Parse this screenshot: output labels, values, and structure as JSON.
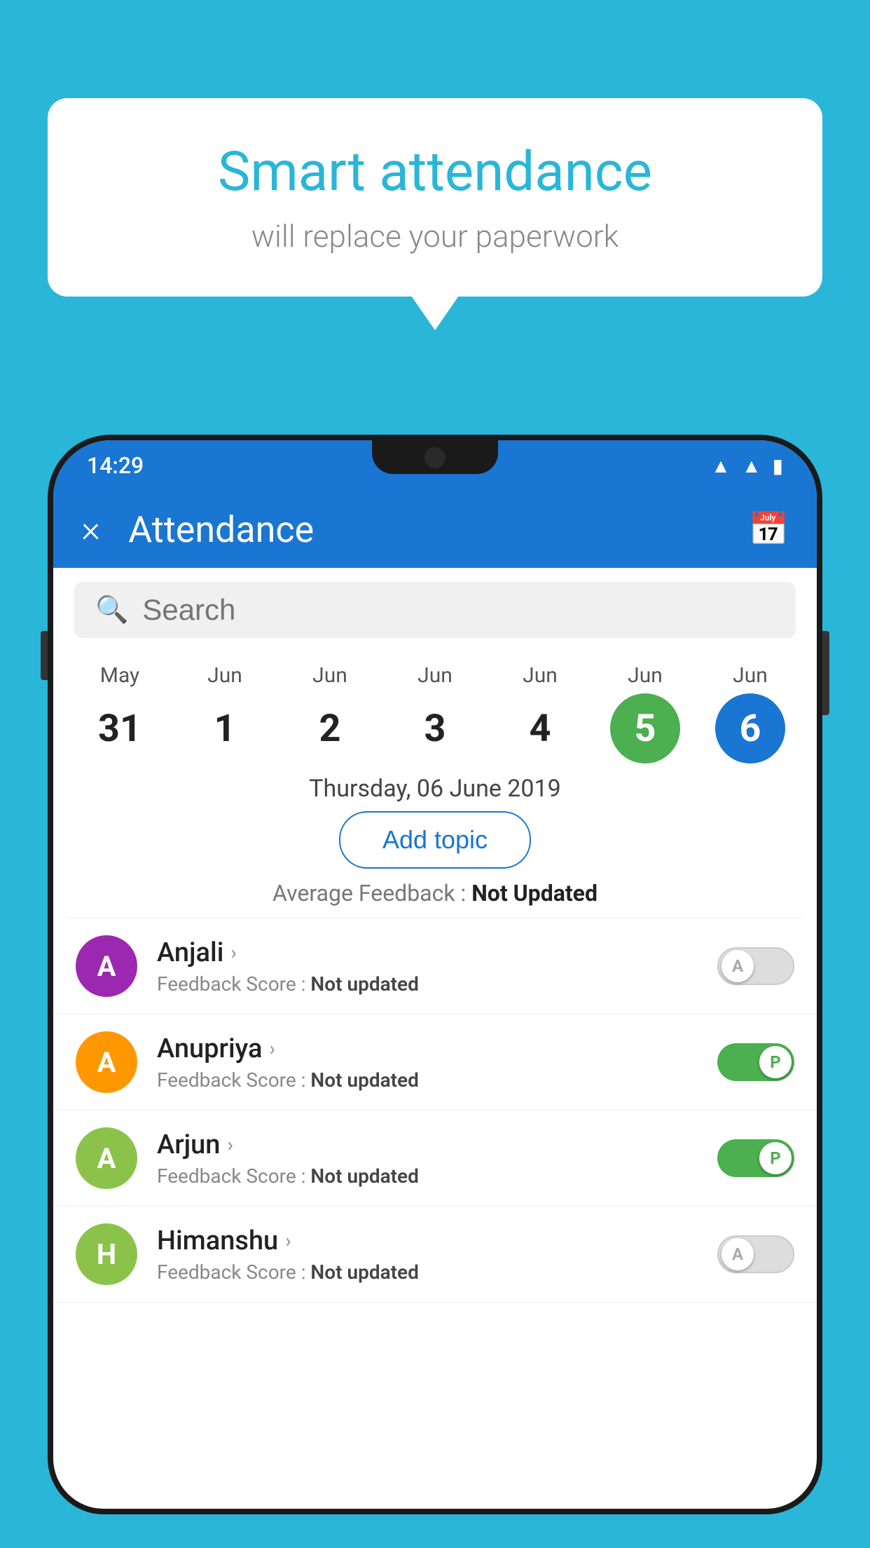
{
  "background_color": "#29b6d8",
  "speech_bubble": {
    "title": "Smart attendance",
    "subtitle": "will replace your paperwork"
  },
  "status_bar": {
    "time": "14:29",
    "wifi": "▲",
    "signal": "▲",
    "battery": "▮"
  },
  "app_bar": {
    "title": "Attendance",
    "close_label": "×"
  },
  "search": {
    "placeholder": "Search"
  },
  "dates": [
    {
      "month": "May",
      "day": "31",
      "style": "normal"
    },
    {
      "month": "Jun",
      "day": "1",
      "style": "normal"
    },
    {
      "month": "Jun",
      "day": "2",
      "style": "normal"
    },
    {
      "month": "Jun",
      "day": "3",
      "style": "normal"
    },
    {
      "month": "Jun",
      "day": "4",
      "style": "normal"
    },
    {
      "month": "Jun",
      "day": "5",
      "style": "today"
    },
    {
      "month": "Jun",
      "day": "6",
      "style": "selected"
    }
  ],
  "selected_date_label": "Thursday, 06 June 2019",
  "add_topic_label": "Add topic",
  "avg_feedback_label": "Average Feedback : ",
  "avg_feedback_value": "Not Updated",
  "students": [
    {
      "name": "Anjali",
      "avatar_letter": "A",
      "avatar_color": "purple",
      "feedback_label": "Feedback Score : ",
      "feedback_value": "Not updated",
      "toggle_state": "off",
      "toggle_letter": "A"
    },
    {
      "name": "Anupriya",
      "avatar_letter": "A",
      "avatar_color": "orange",
      "feedback_label": "Feedback Score : ",
      "feedback_value": "Not updated",
      "toggle_state": "on",
      "toggle_letter": "P"
    },
    {
      "name": "Arjun",
      "avatar_letter": "A",
      "avatar_color": "green",
      "feedback_label": "Feedback Score : ",
      "feedback_value": "Not updated",
      "toggle_state": "on",
      "toggle_letter": "P"
    },
    {
      "name": "Himanshu",
      "avatar_letter": "H",
      "avatar_color": "lime",
      "feedback_label": "Feedback Score : ",
      "feedback_value": "Not updated",
      "toggle_state": "off",
      "toggle_letter": "A"
    }
  ]
}
